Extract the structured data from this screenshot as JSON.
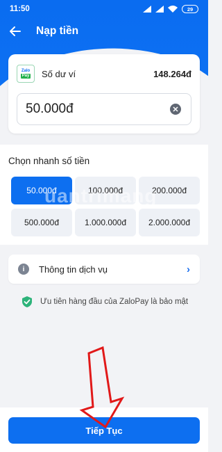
{
  "status_bar": {
    "time": "11:50",
    "battery": "29",
    "icons": [
      "signal-icon",
      "signal-icon",
      "wifi-icon"
    ]
  },
  "app_bar": {
    "title": "Nạp tiền"
  },
  "wallet": {
    "logo": {
      "line1": "Zalo",
      "line2": "Pay"
    },
    "balance_label": "Số dư ví",
    "balance_value": "148.264đ",
    "amount_value": "50.000đ"
  },
  "quick_amount": {
    "title": "Chọn nhanh số tiền",
    "options": [
      {
        "label": "50.000đ",
        "selected": true
      },
      {
        "label": "100.000đ",
        "selected": false
      },
      {
        "label": "200.000đ",
        "selected": false
      },
      {
        "label": "500.000đ",
        "selected": false
      },
      {
        "label": "1.000.000đ",
        "selected": false
      },
      {
        "label": "2.000.000đ",
        "selected": false
      }
    ]
  },
  "service_info": {
    "label": "Thông tin dịch vụ"
  },
  "security_note": "Ưu tiên hàng đầu của ZaloPay là bảo mật",
  "watermark": "uantrimang",
  "continue_button": {
    "label": "Tiếp Tục"
  },
  "colors": {
    "primary": "#0d6ff0",
    "security_green": "#2db37a",
    "annotation_arrow": "#e11919"
  }
}
